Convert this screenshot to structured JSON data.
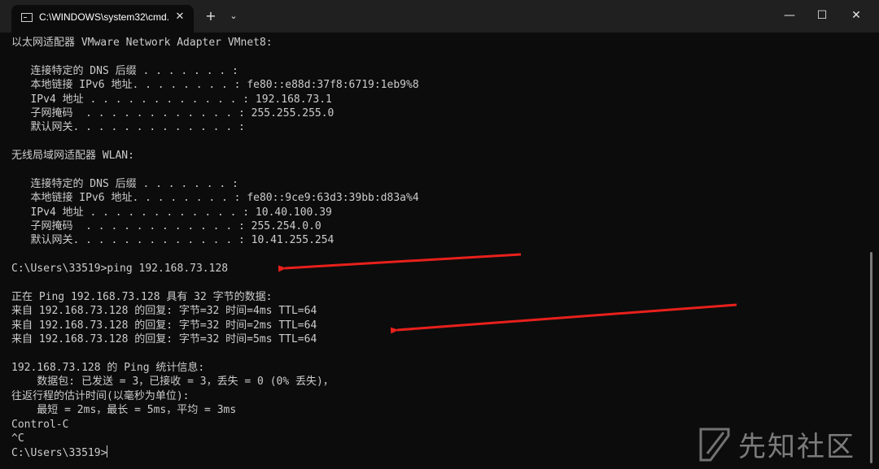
{
  "titlebar": {
    "tab_title": "C:\\WINDOWS\\system32\\cmd.",
    "close_tab_glyph": "✕",
    "new_tab_glyph": "+",
    "dropdown_glyph": "⌄",
    "minimize_glyph": "—",
    "maximize_glyph": "☐",
    "close_glyph": "✕"
  },
  "icons": {
    "tab": "terminal-icon",
    "watermark": "xianzhi-logo-icon"
  },
  "terminal": {
    "lines": [
      "以太网适配器 VMware Network Adapter VMnet8:",
      "",
      "   连接特定的 DNS 后缀 . . . . . . . :",
      "   本地链接 IPv6 地址. . . . . . . . : fe80::e88d:37f8:6719:1eb9%8",
      "   IPv4 地址 . . . . . . . . . . . . : 192.168.73.1",
      "   子网掩码  . . . . . . . . . . . . : 255.255.255.0",
      "   默认网关. . . . . . . . . . . . . :",
      "",
      "无线局域网适配器 WLAN:",
      "",
      "   连接特定的 DNS 后缀 . . . . . . . :",
      "   本地链接 IPv6 地址. . . . . . . . : fe80::9ce9:63d3:39bb:d83a%4",
      "   IPv4 地址 . . . . . . . . . . . . : 10.40.100.39",
      "   子网掩码  . . . . . . . . . . . . : 255.254.0.0",
      "   默认网关. . . . . . . . . . . . . : 10.41.255.254",
      "",
      "C:\\Users\\33519>ping 192.168.73.128",
      "",
      "正在 Ping 192.168.73.128 具有 32 字节的数据:",
      "来自 192.168.73.128 的回复: 字节=32 时间=4ms TTL=64",
      "来自 192.168.73.128 的回复: 字节=32 时间=2ms TTL=64",
      "来自 192.168.73.128 的回复: 字节=32 时间=5ms TTL=64",
      "",
      "192.168.73.128 的 Ping 统计信息:",
      "    数据包: 已发送 = 3，已接收 = 3，丢失 = 0 (0% 丢失)，",
      "往返行程的估计时间(以毫秒为单位):",
      "    最短 = 2ms，最长 = 5ms，平均 = 3ms",
      "Control-C",
      "^C",
      "C:\\Users\\33519>"
    ]
  },
  "colors": {
    "background": "#0c0c0c",
    "titlebar": "#202020",
    "text": "#cccccc",
    "annotation_arrow": "#e8201c"
  },
  "watermark": {
    "text": "先知社区"
  }
}
